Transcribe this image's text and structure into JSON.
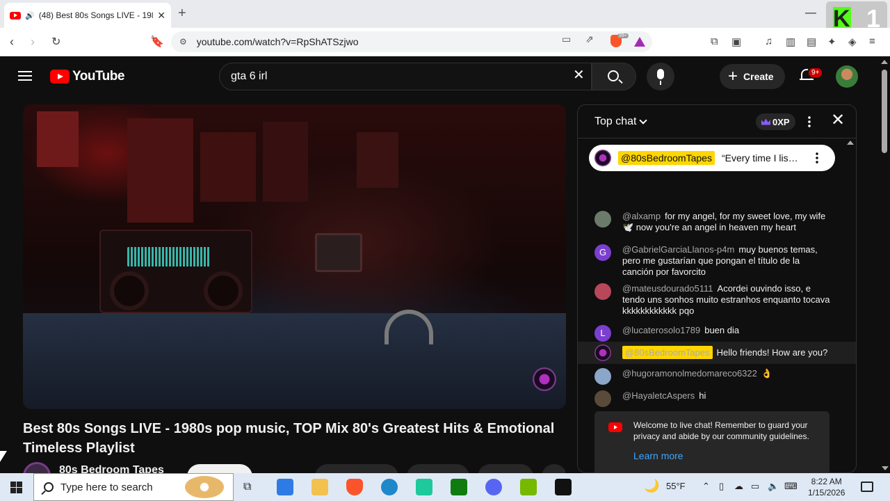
{
  "browser": {
    "tab_title": "(48) Best 80s Songs LIVE - 198",
    "url": "youtube.com/watch?v=RpShATSzjwo",
    "new_tab_label": "+",
    "extension_badge_text": "99+",
    "overlay_badge_number": "1"
  },
  "youtube": {
    "logo_text": "YouTube",
    "search_value": "gta 6 irl",
    "create_label": "Create",
    "notifications_badge": "9+"
  },
  "video": {
    "title": "Best 80s Songs LIVE - 1980s pop music, TOP Mix 80's Greatest Hits & Emotional Timeless Playlist",
    "channel_name": "80s Bedroom Tapes"
  },
  "chat": {
    "mode_label": "Top chat",
    "xp_label": "0XP",
    "pinned": {
      "author": "@80sBedroomTapes",
      "text": "“Every time I lis…"
    },
    "messages": [
      {
        "author": "@alxamp",
        "text": "for my angel, for my sweet love, my wife 🕊️ now you're an angel in heaven my heart",
        "avatar_color": "#6b7b6b",
        "owner": false
      },
      {
        "author": "@GabrielGarciaLlanos-p4m",
        "text": "muy buenos temas, pero me gustarían que pongan el título de la canción por favorcito",
        "avatar_letter": "G",
        "avatar_color": "#7b3fd0",
        "owner": false
      },
      {
        "author": "@mateusdourado5111",
        "text": "Acordei ouvindo isso, e tendo uns sonhos muito estranhos enquanto tocava kkkkkkkkkkkk pqo",
        "avatar_color": "#b8475a",
        "owner": false
      },
      {
        "author": "@lucaterosolo1789",
        "text": "buen dia",
        "avatar_letter": "L",
        "avatar_color": "#7b3fd0",
        "owner": false
      },
      {
        "author": "@80sBedroomTapes",
        "text": "Hello friends! How are you?",
        "avatar_color": "#3a1a44",
        "owner": true
      },
      {
        "author": "@hugoramonolmedomareco6322",
        "text": "👌",
        "avatar_color": "#8aa6c8",
        "owner": false
      },
      {
        "author": "@HayaletcAspers",
        "text": "hi",
        "avatar_color": "#5a4a3a",
        "owner": false
      }
    ],
    "welcome_text": "Welcome to live chat! Remember to guard your privacy and abide by our community guidelines.",
    "learn_more": "Learn more"
  },
  "taskbar": {
    "search_placeholder": "Type here to search",
    "temperature": "55°F",
    "time": "8:22 AM",
    "date": "1/15/2026"
  },
  "colors": {
    "yt_red": "#ff0000",
    "owner_highlight": "#ffd600",
    "link_blue": "#3ea6ff"
  }
}
